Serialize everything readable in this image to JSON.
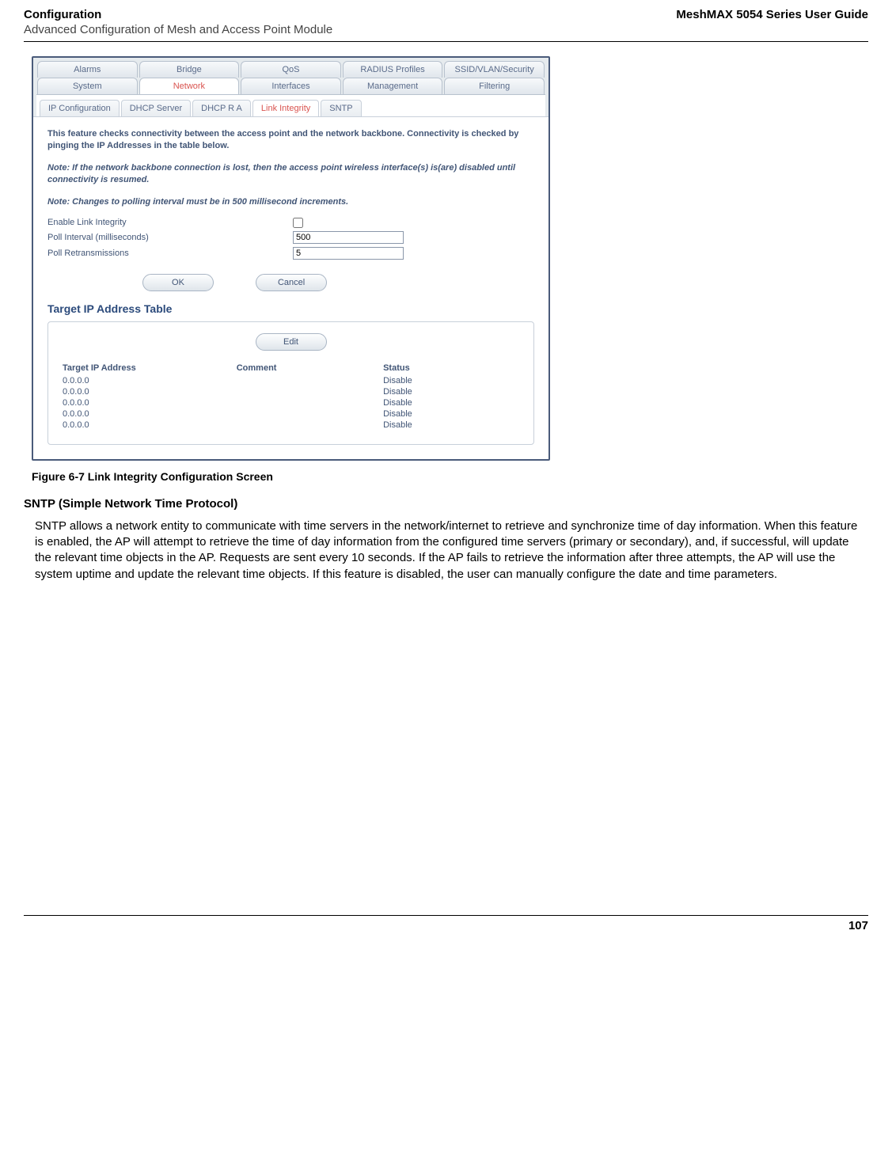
{
  "header": {
    "left": "Configuration",
    "right": "MeshMAX 5054 Series User Guide",
    "sub": "Advanced Configuration of Mesh and Access Point Module"
  },
  "tabs_row1": [
    "Alarms",
    "Bridge",
    "QoS",
    "RADIUS Profiles",
    "SSID/VLAN/Security"
  ],
  "tabs_row2": [
    "System",
    "Network",
    "Interfaces",
    "Management",
    "Filtering"
  ],
  "active_tab": "Network",
  "subtabs": [
    "IP Configuration",
    "DHCP Server",
    "DHCP R A",
    "Link Integrity",
    "SNTP"
  ],
  "active_subtab": "Link Integrity",
  "panel": {
    "desc": "This feature checks connectivity between the access point and the network backbone. Connectivity is checked by pinging the IP Addresses in the table below.",
    "note1": "Note: If the network backbone connection is lost, then the access point wireless interface(s) is(are) disabled until connectivity is resumed.",
    "note2": "Note: Changes to polling interval must be in 500 millisecond increments.",
    "fields": {
      "enable_label": "Enable Link Integrity",
      "poll_interval_label": "Poll Interval (milliseconds)",
      "poll_interval_value": "500",
      "poll_retrans_label": "Poll Retransmissions",
      "poll_retrans_value": "5"
    },
    "buttons": {
      "ok": "OK",
      "cancel": "Cancel",
      "edit": "Edit"
    },
    "table_title": "Target IP Address Table",
    "table_headers": {
      "ip": "Target IP Address",
      "comment": "Comment",
      "status": "Status"
    },
    "table_rows": [
      {
        "ip": "0.0.0.0",
        "comment": "",
        "status": "Disable"
      },
      {
        "ip": "0.0.0.0",
        "comment": "",
        "status": "Disable"
      },
      {
        "ip": "0.0.0.0",
        "comment": "",
        "status": "Disable"
      },
      {
        "ip": "0.0.0.0",
        "comment": "",
        "status": "Disable"
      },
      {
        "ip": "0.0.0.0",
        "comment": "",
        "status": "Disable"
      }
    ]
  },
  "caption": "Figure 6-7 Link Integrity Configuration Screen",
  "subsection_heading": "SNTP (Simple Network Time Protocol)",
  "body_para": "SNTP allows a network entity to communicate with time servers in the network/internet to retrieve and synchronize time of day information. When this feature is enabled, the AP will attempt to retrieve the time of day information from the configured time servers (primary or secondary), and, if successful, will update the relevant time objects in the AP. Requests are sent every 10 seconds. If the AP fails to retrieve the information after three attempts, the AP will use the system uptime and update the relevant time objects. If this feature is disabled, the user can manually configure the date and time parameters.",
  "page_number": "107",
  "chart_data": {
    "type": "table",
    "title": "Target IP Address Table",
    "columns": [
      "Target IP Address",
      "Comment",
      "Status"
    ],
    "rows": [
      [
        "0.0.0.0",
        "",
        "Disable"
      ],
      [
        "0.0.0.0",
        "",
        "Disable"
      ],
      [
        "0.0.0.0",
        "",
        "Disable"
      ],
      [
        "0.0.0.0",
        "",
        "Disable"
      ],
      [
        "0.0.0.0",
        "",
        "Disable"
      ]
    ]
  }
}
